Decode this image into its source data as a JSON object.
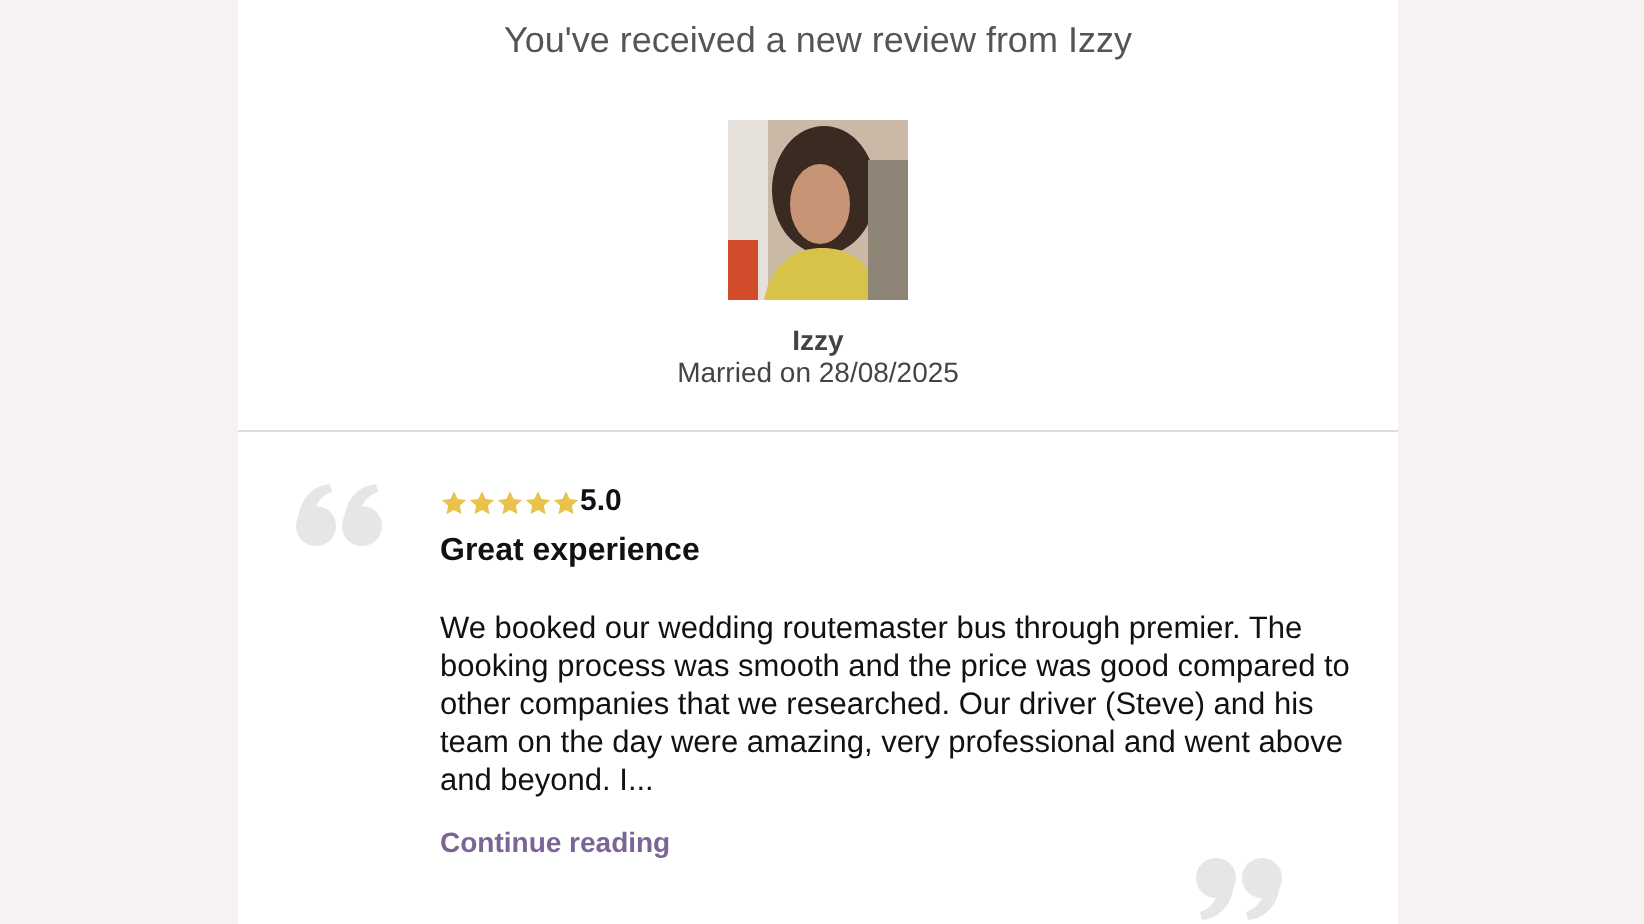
{
  "heading": "You've received a new review from Izzy",
  "reviewer": {
    "name": "Izzy",
    "wedding_date": "Married on 28/08/2025"
  },
  "review": {
    "stars": 5,
    "rating": "5.0",
    "title": "Great experience",
    "body": "We booked our wedding routemaster bus through premier. The booking process was smooth and the price was good compared to other companies that we researched. Our driver (Steve) and his team on the day were amazing, very professional and went above and beyond. I...",
    "link": "Continue reading"
  }
}
